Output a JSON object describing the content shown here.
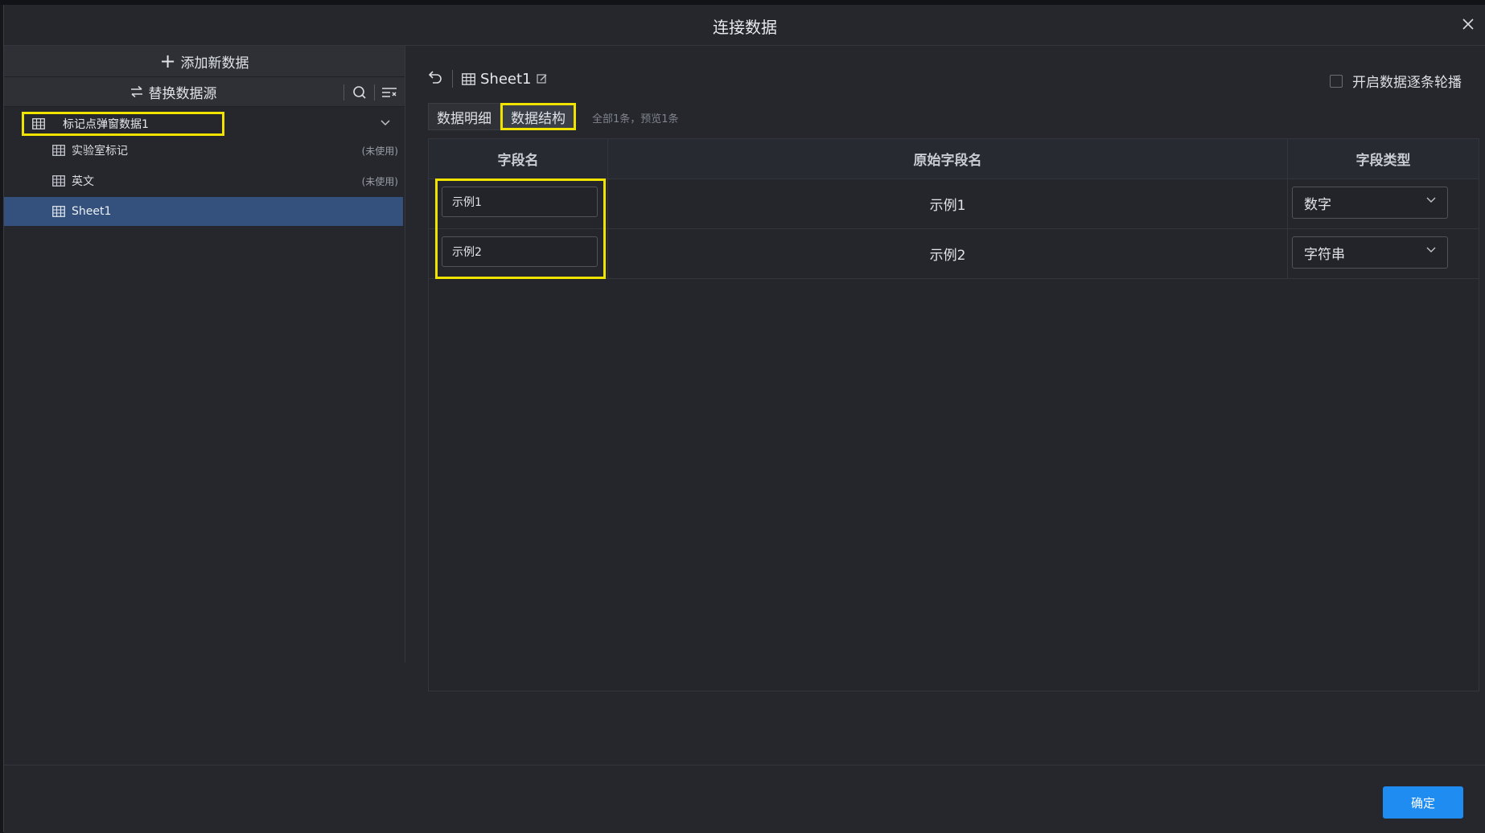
{
  "dialog": {
    "title": "连接数据",
    "close_icon": "close-icon"
  },
  "sidebar": {
    "add_label": "添加新数据",
    "replace_label": "替换数据源",
    "group": {
      "label": "标记点弹窗数据1"
    },
    "items": [
      {
        "label": "实验室标记",
        "tag": "(未使用)"
      },
      {
        "label": "英文",
        "tag": "(未使用)"
      },
      {
        "label": "Sheet1",
        "tag": ""
      }
    ]
  },
  "main": {
    "sheet_name": "Sheet1",
    "carousel_label": "开启数据逐条轮播",
    "tabs": [
      {
        "label": "数据明细"
      },
      {
        "label": "数据结构"
      }
    ],
    "tab_info": "全部1条，预览1条",
    "table": {
      "headers": [
        "字段名",
        "原始字段名",
        "字段类型"
      ],
      "rows": [
        {
          "field_name": "示例1",
          "original": "示例1",
          "type": "数字"
        },
        {
          "field_name": "示例2",
          "original": "示例2",
          "type": "字符串"
        }
      ]
    }
  },
  "footer": {
    "confirm_label": "确定"
  },
  "colors": {
    "accent": "#1e8cf0",
    "selection": "#34507c",
    "highlight": "#f0e300",
    "panel": "#25272d"
  }
}
